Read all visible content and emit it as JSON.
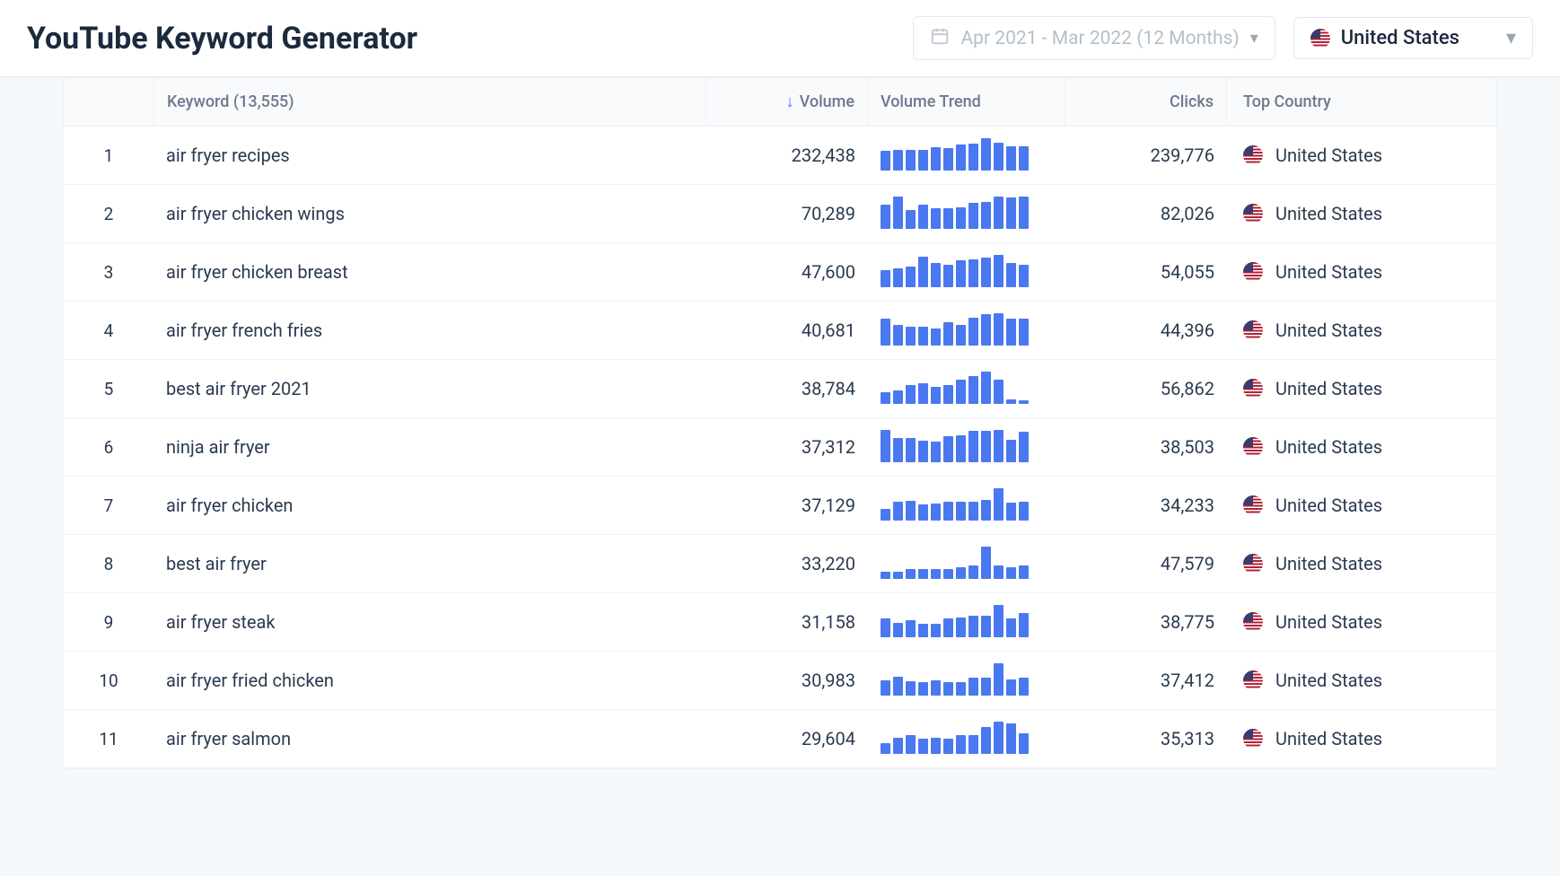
{
  "header": {
    "title": "YouTube Keyword Generator",
    "dateRange": "Apr 2021 - Mar 2022 (12 Months)",
    "country": "United States"
  },
  "columns": {
    "keyword": "Keyword (13,555)",
    "volume": "Volume",
    "trend": "Volume Trend",
    "clicks": "Clicks",
    "topCountry": "Top Country"
  },
  "rows": [
    {
      "n": "1",
      "keyword": "air fryer recipes",
      "volume": "232,438",
      "clicks": "239,776",
      "country": "United States",
      "trend": [
        58,
        60,
        60,
        60,
        68,
        66,
        75,
        80,
        95,
        82,
        70,
        72
      ]
    },
    {
      "n": "2",
      "keyword": "air fryer chicken wings",
      "volume": "70,289",
      "clicks": "82,026",
      "country": "United States",
      "trend": [
        72,
        95,
        55,
        72,
        60,
        60,
        62,
        75,
        80,
        95,
        92,
        95
      ]
    },
    {
      "n": "3",
      "keyword": "air fryer chicken breast",
      "volume": "47,600",
      "clicks": "54,055",
      "country": "United States",
      "trend": [
        50,
        55,
        60,
        90,
        72,
        65,
        78,
        82,
        88,
        95,
        72,
        65
      ]
    },
    {
      "n": "4",
      "keyword": "air fryer french fries",
      "volume": "40,681",
      "clicks": "44,396",
      "country": "United States",
      "trend": [
        80,
        60,
        55,
        55,
        50,
        68,
        60,
        82,
        92,
        95,
        80,
        78
      ]
    },
    {
      "n": "5",
      "keyword": "best air fryer 2021",
      "volume": "38,784",
      "clicks": "56,862",
      "country": "United States",
      "trend": [
        35,
        40,
        55,
        60,
        50,
        55,
        72,
        82,
        95,
        70,
        12,
        10
      ]
    },
    {
      "n": "6",
      "keyword": "ninja air fryer",
      "volume": "37,312",
      "clicks": "38,503",
      "country": "United States",
      "trend": [
        95,
        70,
        72,
        62,
        60,
        75,
        78,
        92,
        92,
        95,
        65,
        90
      ]
    },
    {
      "n": "7",
      "keyword": "air fryer chicken",
      "volume": "37,129",
      "clicks": "34,233",
      "country": "United States",
      "trend": [
        35,
        55,
        58,
        48,
        50,
        55,
        55,
        55,
        60,
        95,
        52,
        55
      ]
    },
    {
      "n": "8",
      "keyword": "best air fryer",
      "volume": "33,220",
      "clicks": "47,579",
      "country": "United States",
      "trend": [
        22,
        20,
        30,
        30,
        30,
        28,
        35,
        40,
        95,
        40,
        35,
        40
      ]
    },
    {
      "n": "9",
      "keyword": "air fryer steak",
      "volume": "31,158",
      "clicks": "38,775",
      "country": "United States",
      "trend": [
        55,
        42,
        50,
        40,
        40,
        55,
        58,
        62,
        62,
        95,
        55,
        72
      ]
    },
    {
      "n": "10",
      "keyword": "air fryer fried chicken",
      "volume": "30,983",
      "clicks": "37,412",
      "country": "United States",
      "trend": [
        45,
        55,
        42,
        40,
        45,
        40,
        40,
        52,
        52,
        95,
        48,
        52
      ]
    },
    {
      "n": "11",
      "keyword": "air fryer salmon",
      "volume": "29,604",
      "clicks": "35,313",
      "country": "United States",
      "trend": [
        32,
        48,
        55,
        45,
        48,
        45,
        55,
        55,
        80,
        95,
        90,
        60
      ]
    }
  ]
}
